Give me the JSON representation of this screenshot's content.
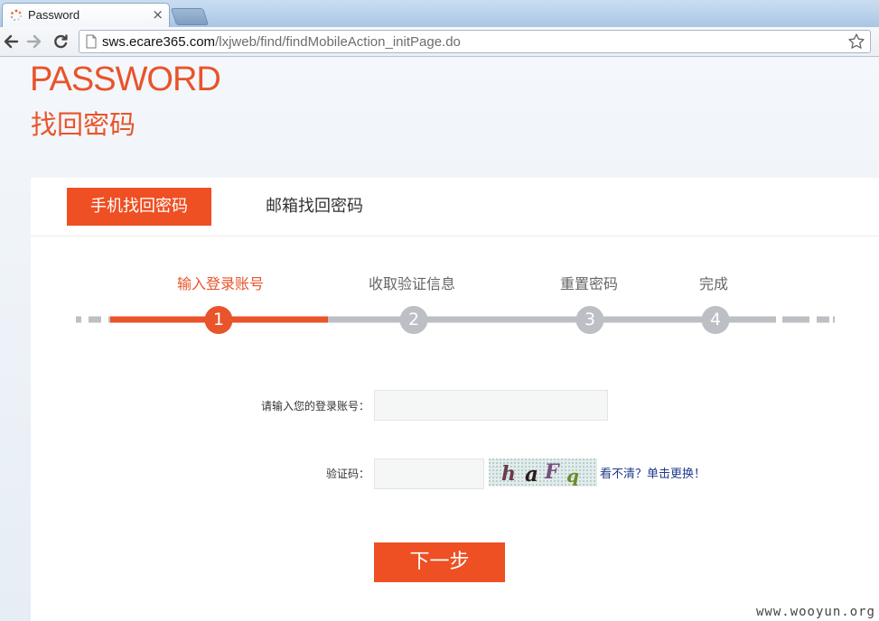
{
  "browser": {
    "tab_title": "Password",
    "url_host": "sws.ecare365.com",
    "url_path": "/lxjweb/find/findMobileAction_initPage.do"
  },
  "header": {
    "brand_en": "PASSWORD",
    "brand_cn": "找回密码"
  },
  "tabs": {
    "mobile": "手机找回密码",
    "email": "邮箱找回密码"
  },
  "steps": [
    {
      "label": "输入登录账号",
      "num": "1"
    },
    {
      "label": "收取验证信息",
      "num": "2"
    },
    {
      "label": "重置密码",
      "num": "3"
    },
    {
      "label": "完成",
      "num": "4"
    }
  ],
  "active_step": 1,
  "form": {
    "account_label": "请输入您的登录账号：",
    "account_value": "",
    "captcha_label": "验证码：",
    "captcha_value": "",
    "captcha_text": "haFq",
    "captcha_refresh": "看不清？单击更换！",
    "next_button": "下一步"
  },
  "watermark": "www.wooyun.org",
  "colors": {
    "accent": "#ee4f23",
    "step_inactive": "#bcbfc3",
    "link": "#1f3a8a"
  }
}
